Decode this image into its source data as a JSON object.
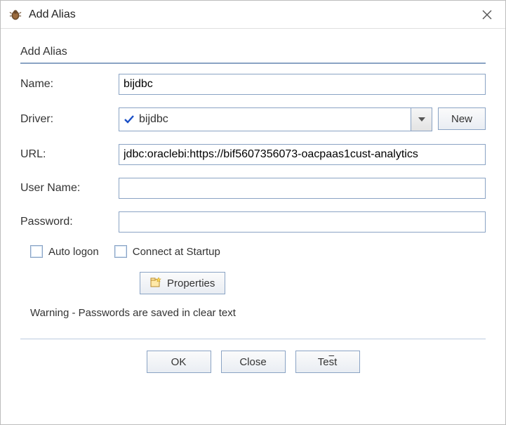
{
  "window": {
    "title": "Add Alias"
  },
  "group": {
    "title": "Add Alias"
  },
  "form": {
    "name": {
      "label": "Name:",
      "value": "bijdbc"
    },
    "driver": {
      "label": "Driver:",
      "selected": "bijdbc",
      "new_button": "New"
    },
    "url": {
      "label": "URL:",
      "value": "jdbc:oraclebi:https://bif5607356073-oacpaas1cust-analytics"
    },
    "username": {
      "label": "User Name:",
      "value": ""
    },
    "password": {
      "label": "Password:",
      "value": ""
    }
  },
  "checkboxes": {
    "auto_logon": {
      "label": "Auto logon",
      "checked": false
    },
    "connect_startup": {
      "label": "Connect at Startup",
      "checked": false
    }
  },
  "properties_button": "Properties",
  "warning_text": "Warning - Passwords are saved in clear text",
  "buttons": {
    "ok": "OK",
    "close": "Close",
    "test_prefix": "Te",
    "test_mnemonic": "s",
    "test_suffix": "t"
  }
}
